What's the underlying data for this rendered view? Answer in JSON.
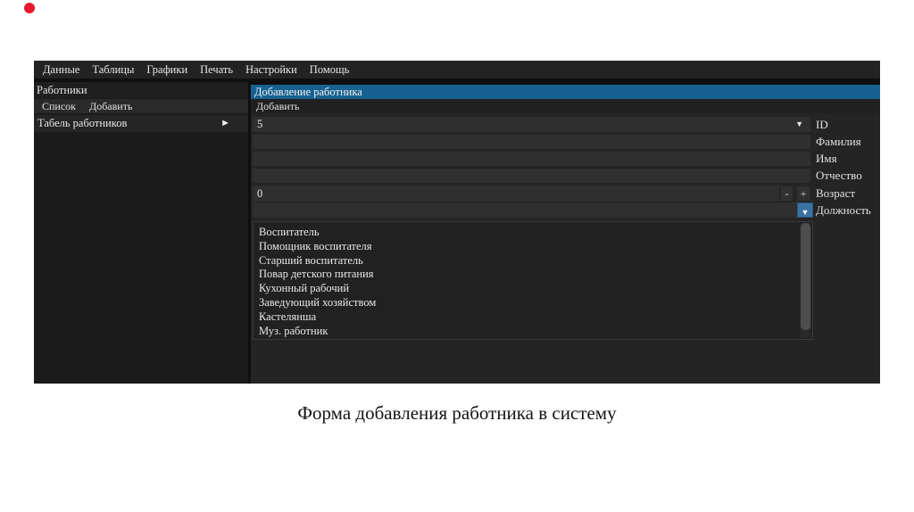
{
  "slide": {
    "caption": "Форма добавления работника в систему"
  },
  "window": {
    "menu_bar": {
      "items": [
        "Данные",
        "Таблицы",
        "Графики",
        "Печать",
        "Настройки",
        "Помощь"
      ]
    },
    "sidebar": {
      "title": "Работники",
      "submenu": [
        "Список",
        "Добавить"
      ],
      "tree_item": "Табель работников"
    },
    "main": {
      "tab_title": "Добавление работника",
      "menu_item": "Добавить",
      "fields": [
        {
          "label": "ID",
          "value": "5"
        },
        {
          "label": "Фамилия",
          "value": ""
        },
        {
          "label": "Имя",
          "value": ""
        },
        {
          "label": "Отчество",
          "value": ""
        },
        {
          "label": "Возраст",
          "value": "0"
        },
        {
          "label": "Должность",
          "value": ""
        }
      ],
      "positions": [
        "Воспитатель",
        "Помощник воспитателя",
        "Старший воспитатель",
        "Повар детского питания",
        "Кухонный рабочий",
        "Заведующий хозяйством",
        "Кастелянша",
        "Муз. работник"
      ]
    }
  },
  "icons": {
    "dropdown": "▼",
    "expand_right": "►",
    "minus": "-",
    "plus": "+"
  },
  "colors": {
    "tab_accent": "#176190",
    "combo_button": "#3a72a2",
    "record_dot": "#e8192c",
    "panel_dark": "#242424",
    "field_bg": "#2f2f2f"
  }
}
